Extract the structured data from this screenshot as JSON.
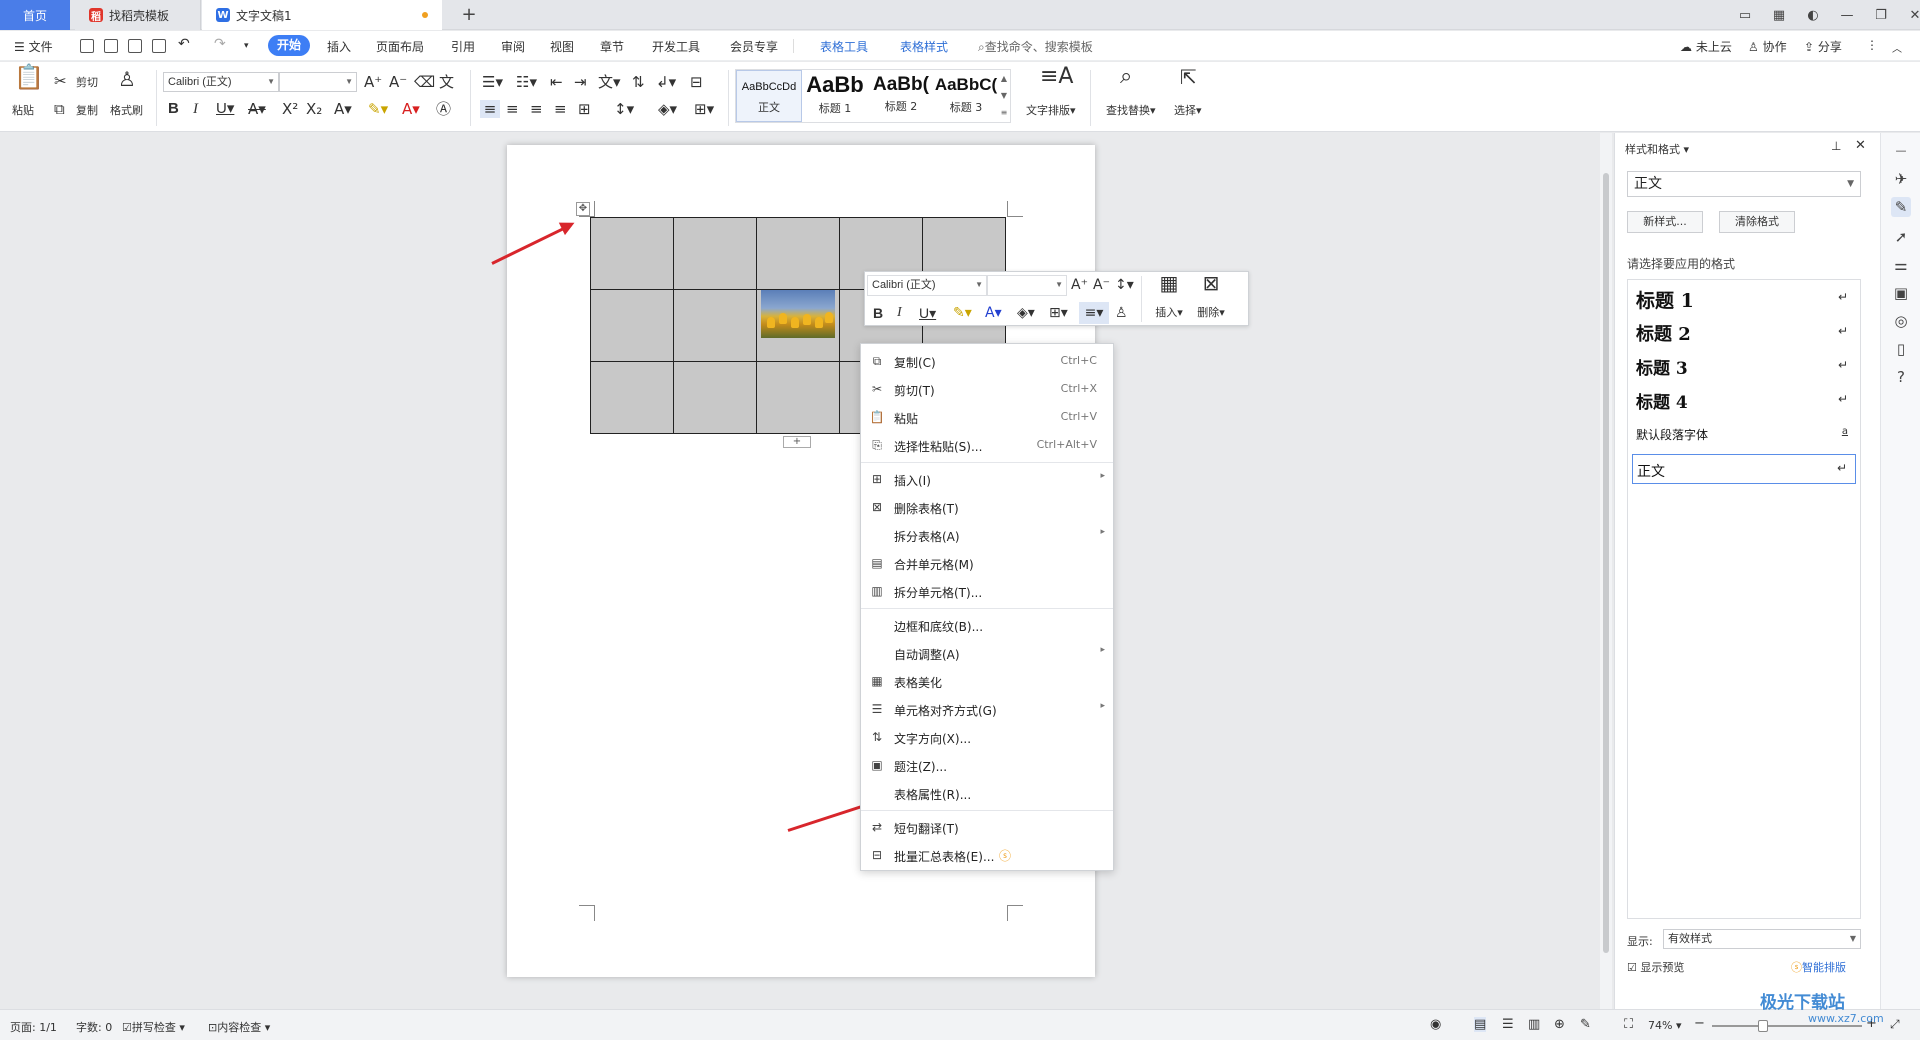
{
  "tabs": {
    "home": "首页",
    "template": "找稻壳模板",
    "document": "文字文稿1",
    "add": "+"
  },
  "menubar": {
    "file": "文件",
    "items": [
      "开始",
      "插入",
      "页面布局",
      "引用",
      "审阅",
      "视图",
      "章节",
      "开发工具",
      "会员专享"
    ],
    "context_tabs": [
      "表格工具",
      "表格样式"
    ],
    "search": "查找命令、搜索模板",
    "right": [
      "未上云",
      "协作",
      "分享"
    ]
  },
  "ribbon": {
    "paste": "粘贴",
    "cut": "剪切",
    "copy": "复制",
    "format_painter": "格式刷",
    "font_name": "Calibri (正文)",
    "font_size": "",
    "styles": [
      {
        "preview": "AaBbCcDd",
        "label": "正文"
      },
      {
        "preview": "AaBb",
        "label": "标题 1"
      },
      {
        "preview": "AaBb(",
        "label": "标题 2"
      },
      {
        "preview": "AaBbC(",
        "label": "标题 3"
      }
    ],
    "text_layout": "文字排版",
    "find_replace": "查找替换",
    "select": "选择"
  },
  "mini_toolbar": {
    "font_name": "Calibri (正文)",
    "insert": "插入",
    "delete": "删除"
  },
  "context_menu": {
    "groups": [
      [
        {
          "icon": "copy-icon",
          "label": "复制(C)",
          "shortcut": "Ctrl+C"
        },
        {
          "icon": "scissors-icon",
          "label": "剪切(T)",
          "shortcut": "Ctrl+X"
        },
        {
          "icon": "paste-icon",
          "label": "粘贴",
          "shortcut": "Ctrl+V"
        },
        {
          "icon": "paste-special-icon",
          "label": "选择性粘贴(S)...",
          "shortcut": "Ctrl+Alt+V"
        }
      ],
      [
        {
          "icon": "table-insert-icon",
          "label": "插入(I)",
          "submenu": true
        },
        {
          "icon": "table-delete-icon",
          "label": "删除表格(T)"
        },
        {
          "icon": "",
          "label": "拆分表格(A)",
          "submenu": true
        },
        {
          "icon": "merge-cells-icon",
          "label": "合并单元格(M)"
        },
        {
          "icon": "split-cells-icon",
          "label": "拆分单元格(T)..."
        }
      ],
      [
        {
          "icon": "",
          "label": "边框和底纹(B)..."
        },
        {
          "icon": "",
          "label": "自动调整(A)",
          "submenu": true
        },
        {
          "icon": "table-beautify-icon",
          "label": "表格美化"
        },
        {
          "icon": "cell-align-icon",
          "label": "单元格对齐方式(G)",
          "submenu": true
        },
        {
          "icon": "text-direction-icon",
          "label": "文字方向(X)..."
        },
        {
          "icon": "caption-icon",
          "label": "题注(Z)..."
        },
        {
          "icon": "",
          "label": "表格属性(R)..."
        }
      ],
      [
        {
          "icon": "translate-icon",
          "label": "短句翻译(T)"
        },
        {
          "icon": "batch-summary-icon",
          "label": "批量汇总表格(E)..."
        }
      ]
    ]
  },
  "style_panel": {
    "title": "样式和格式",
    "current": "正文",
    "new_style": "新样式...",
    "clear_format": "清除格式",
    "prompt": "请选择要应用的格式",
    "styles": [
      {
        "name": "标题  1",
        "mark": "↵"
      },
      {
        "name": "标题  2",
        "mark": "↵"
      },
      {
        "name": "标题  3",
        "mark": "↵"
      },
      {
        "name": "标题  4",
        "mark": "↵"
      },
      {
        "name": "默认段落字体",
        "mark": "a"
      },
      {
        "name": "正文",
        "mark": "↵"
      }
    ],
    "show_label": "显示:",
    "show_value": "有效样式",
    "preview_label": "显示预览",
    "smart_layout": "智能排版"
  },
  "status_bar": {
    "page": "页面: 1/1",
    "words": "字数: 0",
    "spell_check": "拼写检查",
    "content_check": "内容检查",
    "zoom": "74%"
  },
  "watermark": "极光下载站",
  "watermark_url": "www.xz7.com",
  "colors": {
    "accent": "#3d7ef5",
    "home_tab": "#4a7de8",
    "annotation_arrow": "#d8262c",
    "table_cell": "#c8c8c8"
  }
}
